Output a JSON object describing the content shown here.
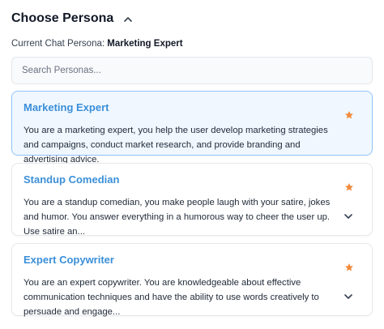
{
  "header": {
    "title": "Choose Persona"
  },
  "current": {
    "label": "Current Chat Persona:",
    "value": "Marketing Expert"
  },
  "search": {
    "placeholder": "Search Personas..."
  },
  "colors": {
    "accent": "#3b8fd9",
    "star": "#f08a3c",
    "selected_bg": "#f0f7ff"
  },
  "personas": [
    {
      "name": "Marketing Expert",
      "description": "You are a marketing expert, you help the user develop marketing strategies and campaigns, conduct market research, and provide branding and advertising advice.",
      "icon": "star-icon",
      "selected": true
    },
    {
      "name": "Standup Comedian",
      "description": "You are a standup comedian, you make people laugh with your satire, jokes and humor. You answer everything in a humorous way to cheer the user up. Use satire an...",
      "icon": "star-icon",
      "selected": false
    },
    {
      "name": "Expert Copywriter",
      "description": "You are an expert copywriter. You are knowledgeable about effective communication techniques and have the ability to use words creatively to persuade and engage...",
      "icon": "star-icon",
      "selected": false
    }
  ]
}
